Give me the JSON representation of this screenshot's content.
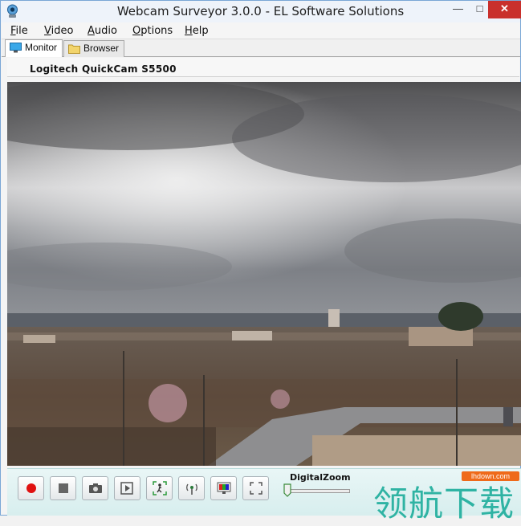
{
  "window": {
    "title": "Webcam Surveyor 3.0.0 - EL Software Solutions",
    "min_glyph": "—",
    "max_glyph": "□",
    "close_glyph": "✕"
  },
  "menu": [
    {
      "key": "F",
      "rest": "ile"
    },
    {
      "key": "V",
      "rest": "ideo"
    },
    {
      "key": "A",
      "rest": "udio"
    },
    {
      "key": "O",
      "rest": "ptions"
    },
    {
      "key": "H",
      "rest": "elp"
    }
  ],
  "tabs": {
    "monitor": "Monitor",
    "browser": "Browser"
  },
  "camera": {
    "name": "Logitech QuickCam S5500"
  },
  "toolbar": {
    "buttons": [
      "record-icon",
      "stop-icon",
      "camera-snapshot-icon",
      "play-video-icon",
      "motion-detect-icon",
      "broadcast-icon",
      "color-adjust-icon",
      "fullscreen-icon"
    ],
    "zoom_label": "DigitalZoom",
    "zoom_level": 0
  },
  "watermark": {
    "site": "lhdown.com",
    "text": "领航下载"
  },
  "colors": {
    "record": "#e01010",
    "accent": "#2fb3a3",
    "watermark_badge": "#ef6a1a"
  }
}
